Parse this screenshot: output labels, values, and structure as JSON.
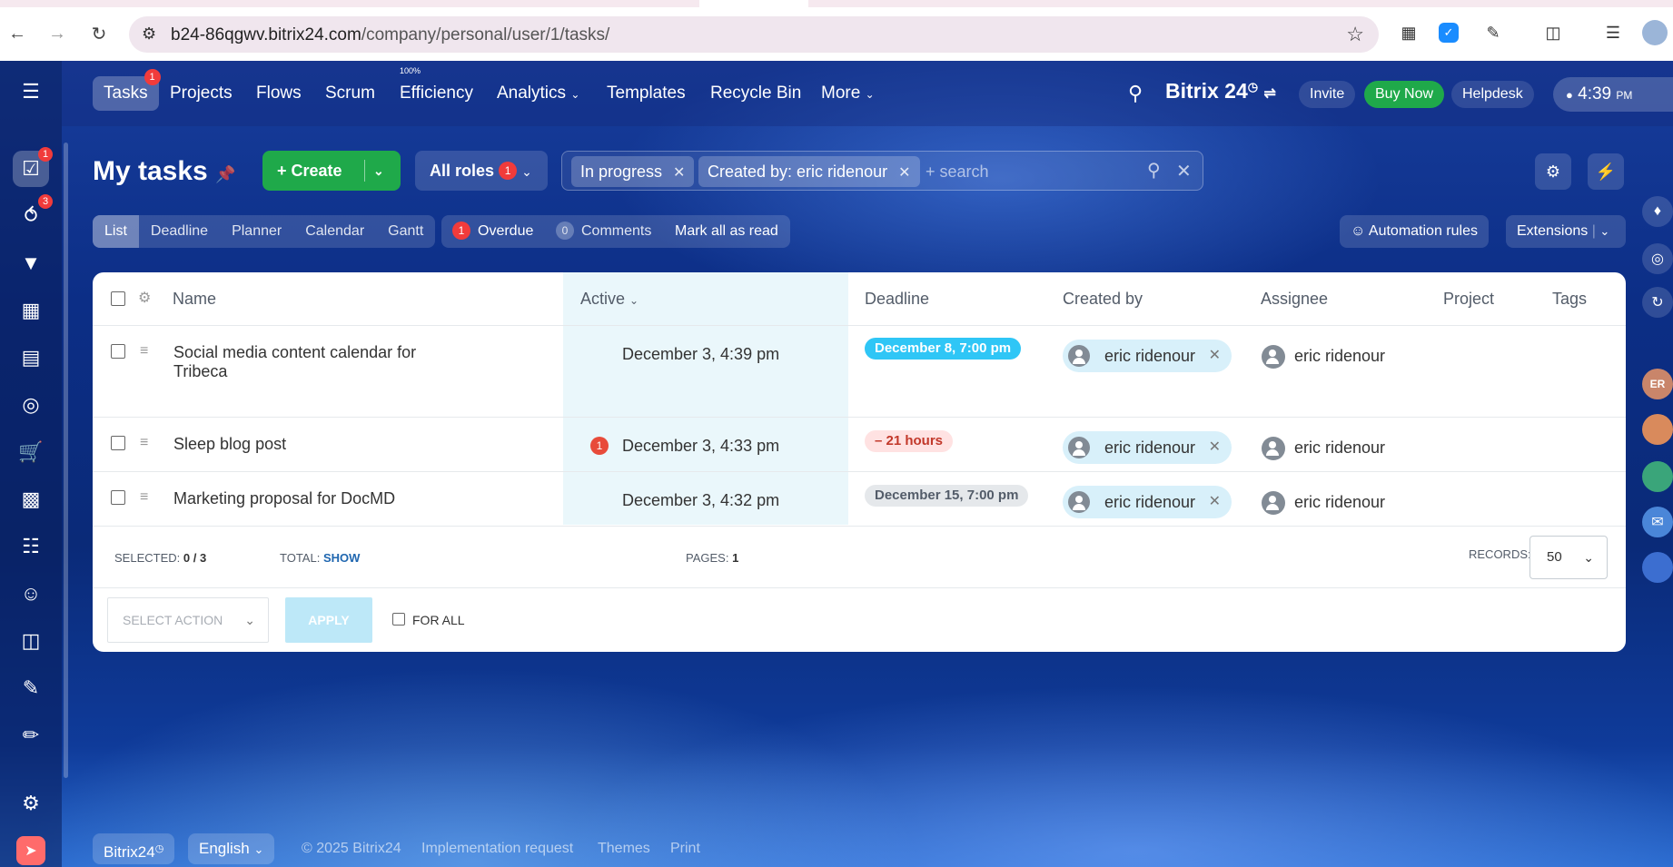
{
  "browser": {
    "url_host": "b24-86qgwv.bitrix24.com",
    "url_path": "/company/personal/user/1/tasks/"
  },
  "nav": {
    "items": [
      {
        "label": "Tasks",
        "badge": "1"
      },
      {
        "label": "Projects"
      },
      {
        "label": "Flows"
      },
      {
        "label": "Scrum"
      },
      {
        "label": "Efficiency",
        "sup": "100%"
      },
      {
        "label": "Analytics"
      },
      {
        "label": "Templates"
      },
      {
        "label": "Recycle Bin"
      },
      {
        "label": "More"
      }
    ],
    "logo": "Bitrix 24",
    "invite": "Invite",
    "buy_now": "Buy Now",
    "helpdesk": "Helpdesk",
    "clock": "4:39",
    "clock_suffix": "PM"
  },
  "leftbar": {
    "tasks_badge": "1",
    "flows_badge": "3"
  },
  "page": {
    "title": "My tasks",
    "create_label": "Create",
    "roles_label": "All roles",
    "roles_badge": "1",
    "filter_chips": [
      "In progress",
      "Created by: eric ridenour"
    ],
    "search_placeholder": "+ search"
  },
  "views": [
    "List",
    "Deadline",
    "Planner",
    "Calendar",
    "Gantt"
  ],
  "counters": {
    "overdue_count": "1",
    "overdue_label": "Overdue",
    "comments_count": "0",
    "comments_label": "Comments",
    "mark_read": "Mark all as read"
  },
  "toolbar_right": {
    "automation": "Automation rules",
    "extensions": "Extensions"
  },
  "grid": {
    "headers": {
      "name": "Name",
      "active": "Active",
      "deadline": "Deadline",
      "created_by": "Created by",
      "assignee": "Assignee",
      "project": "Project",
      "tags": "Tags"
    },
    "rows": [
      {
        "name": "Social media content calendar for",
        "name2": "Tribeca",
        "active": "December 3, 4:39 pm",
        "deadline": "December 8, 7:00 pm",
        "deadline_state": "cyan",
        "created_by": "eric ridenour",
        "assignee": "eric ridenour"
      },
      {
        "name": "Sleep blog post",
        "badge": "1",
        "active": "December 3, 4:33 pm",
        "deadline": "– 21 hours",
        "deadline_state": "overdue",
        "created_by": "eric ridenour",
        "assignee": "eric ridenour"
      },
      {
        "name": "Marketing proposal for DocMD",
        "active": "December 3, 4:32 pm",
        "deadline": "December 15, 7:00 pm",
        "deadline_state": "grey",
        "created_by": "eric ridenour",
        "assignee": "eric ridenour"
      }
    ],
    "footer": {
      "selected_label": "SELECTED:",
      "selected_value": "0 / 3",
      "total_label": "TOTAL:",
      "total_link": "SHOW",
      "pages_label": "PAGES:",
      "pages_value": "1",
      "records_label": "RECORDS:",
      "records_value": "50"
    },
    "actions": {
      "select_action": "SELECT ACTION",
      "apply": "APPLY",
      "for_all": "FOR ALL"
    }
  },
  "footer": {
    "brand": "Bitrix24",
    "language": "English",
    "copyright": "© 2025 Bitrix24",
    "links": [
      "Implementation request",
      "Themes",
      "Print"
    ]
  },
  "colors": {
    "accent_green": "#1fa94a",
    "deadline_cyan": "#2fc6f6",
    "overdue_red": "#f13b3b"
  }
}
